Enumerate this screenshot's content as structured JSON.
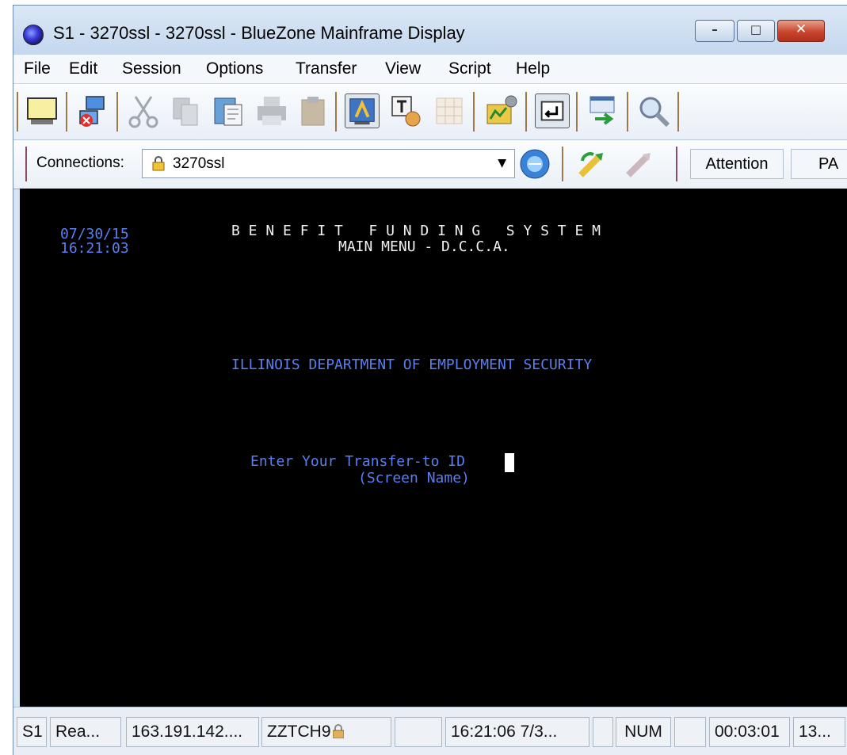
{
  "window": {
    "title": "S1 - 3270ssl - 3270ssl - BlueZone Mainframe Display",
    "controls": {
      "minimize": "–",
      "maximize": "□",
      "close": "✕"
    }
  },
  "menu": {
    "items": [
      "File",
      "Edit",
      "Session",
      "Options",
      "Transfer",
      "View",
      "Script",
      "Help"
    ]
  },
  "toolbar": {
    "icons": [
      "display-icon",
      "disconnect-icon",
      "cut-icon",
      "copy-icon",
      "paste-special-icon",
      "print-icon",
      "clipboard-icon",
      "connect-session-icon",
      "text-font-icon",
      "grid-icon",
      "macro-icon",
      "enter-key-icon",
      "transfer-icon",
      "find-icon"
    ]
  },
  "connections": {
    "label": "Connections:",
    "selected": "3270ssl",
    "attention_label": "Attention",
    "pa_label": "PA"
  },
  "terminal": {
    "date": "07/30/15",
    "time": "16:21:03",
    "system_title": "B E N E F I T   F U N D I N G   S Y S T E M",
    "menu_title": "MAIN MENU - D.C.C.A.",
    "department": "ILLINOIS DEPARTMENT OF EMPLOYMENT SECURITY",
    "prompt": "Enter Your Transfer-to ID",
    "prompt_hint": "(Screen Name)"
  },
  "statusbar": {
    "session": "S1",
    "state": "Rea...",
    "host": "163.191.142....",
    "lu": "ZZTCH9",
    "blank1": "",
    "clock": "16:21:06  7/3...",
    "blank2": "",
    "num": "NUM",
    "blank3": "",
    "elapsed": "00:03:01",
    "extra": "13..."
  },
  "colors": {
    "terminal_bg": "#000000",
    "terminal_blue": "#5b7ff0",
    "terminal_white": "#f2f2f2",
    "window_frame": "#d7e4f2"
  }
}
